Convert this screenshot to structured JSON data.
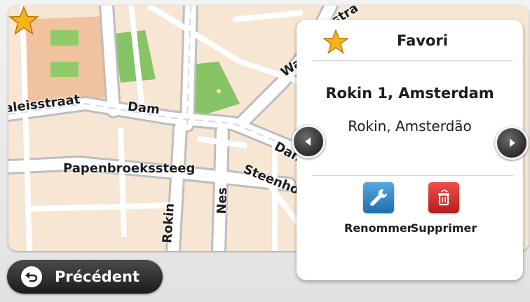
{
  "map": {
    "streets": [
      {
        "id": "raadhuisstraat",
        "name": "aleisstraat"
      },
      {
        "id": "dam",
        "name": "Dam"
      },
      {
        "id": "papenbroekssteeg",
        "name": "Papenbroekssteeg"
      },
      {
        "id": "rokin",
        "name": "Rokin"
      },
      {
        "id": "nes",
        "name": "Nes"
      },
      {
        "id": "steenhouwersteeg",
        "name": "Steenho"
      },
      {
        "id": "damstraat",
        "name": "Dam"
      },
      {
        "id": "warmoesstraat",
        "name": "Wa"
      },
      {
        "id": "top-street",
        "name": "stra"
      }
    ],
    "marker_icon": "star-icon"
  },
  "panel": {
    "title": "Favori",
    "title_icon": "star-icon",
    "address_main": "Rokin 1, Amsterdam",
    "address_sub": "Rokin, Amsterdão",
    "prev_icon": "chevron-left-icon",
    "next_icon": "chevron-right-icon",
    "actions": [
      {
        "label": "Renommer",
        "icon": "wrench-icon",
        "color": "#2f86c9"
      },
      {
        "label": "Supprimer",
        "icon": "trash-icon",
        "color": "#d42a2a"
      }
    ]
  },
  "back": {
    "label": "Précédent",
    "icon": "back-arrow-icon"
  },
  "colors": {
    "map_background": "#f7e7d6",
    "road": "#ffffff",
    "park": "#7fbf5e",
    "building": "#f2c6a4",
    "star": "#f5b019"
  }
}
